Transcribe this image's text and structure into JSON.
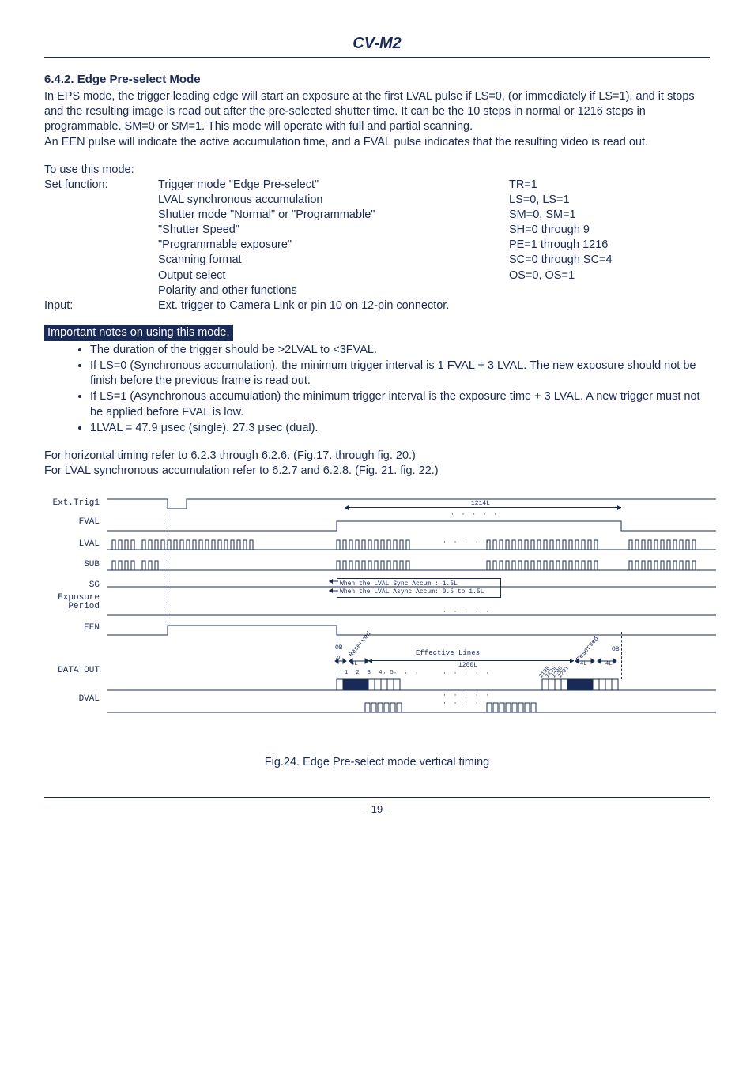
{
  "header": {
    "title": "CV-M2"
  },
  "section": {
    "number_title": "6.4.2. Edge Pre-select Mode",
    "para1": "In EPS mode, the trigger leading edge will start an exposure at the first LVAL pulse if LS=0, (or immediately if LS=1), and it stops and the resulting image is read out after the pre-selected shutter time. It can be the 10 steps in normal or 1216 steps in programmable. SM=0 or SM=1. This mode will operate with full and partial scanning.",
    "para2": "An EEN pulse will indicate the active accumulation time, and a FVAL pulse indicates that the resulting video is read out."
  },
  "settings": {
    "intro": "To use this mode:",
    "label1": "Set function:",
    "label2": "Input:",
    "rows": [
      {
        "name": "Trigger mode \"Edge Pre-select\"",
        "val": "TR=1"
      },
      {
        "name": "LVAL synchronous accumulation",
        "val": "LS=0, LS=1"
      },
      {
        "name": "Shutter mode \"Normal\" or \"Programmable\"",
        "val": "SM=0, SM=1"
      },
      {
        "name": "\"Shutter Speed\"",
        "val": "SH=0 through 9"
      },
      {
        "name": "\"Programmable exposure\"",
        "val": "PE=1 through 1216"
      },
      {
        "name": "Scanning format",
        "val": "SC=0 through SC=4"
      },
      {
        "name": "Output select",
        "val": "OS=0, OS=1"
      },
      {
        "name": "Polarity and other functions",
        "val": ""
      }
    ],
    "input_line": "Ext. trigger to Camera Link or pin 10 on 12-pin connector."
  },
  "notes": {
    "heading": "Important notes on using this mode.",
    "items": [
      "The duration of the trigger should be >2LVAL to <3FVAL.",
      "If LS=0 (Synchronous accumulation), the minimum trigger interval is 1 FVAL + 3 LVAL. The new exposure should not be finish before the previous frame is read out.",
      "If LS=1 (Asynchronous accumulation) the minimum trigger interval is the exposure time + 3 LVAL. A new trigger must not be applied before FVAL is low.",
      "1LVAL = 47.9 μsec (single). 27.3 μsec (dual)."
    ]
  },
  "refs": {
    "line1": "For horizontal timing refer to 6.2.3 through 6.2.6. (Fig.17. through fig. 20.)",
    "line2": "For LVAL synchronous accumulation refer to 6.2.7 and 6.2.8. (Fig. 21. fig. 22.)"
  },
  "diagram": {
    "signals": [
      "Ext.Trig1",
      "FVAL",
      "LVAL",
      "SUB",
      "SG",
      "Exposure Period",
      "EEN",
      "DATA OUT",
      "DVAL"
    ],
    "span_1214L": "1214L",
    "note_sync": "When the LVAL Sync Accum : 1.5L",
    "note_async": "When the LVAL Async Accum: 0.5 to 1.5L",
    "OB": "OB",
    "reserved": "Reserved",
    "twoL": "2L",
    "fourL": "4L",
    "effective_lines": "Effective Lines",
    "span_1200L": "1200L",
    "data_count": "1 2 3 4 5",
    "tick1": "1198",
    "tick2": "1199",
    "tick3": "1200",
    "tick4": "1201"
  },
  "figure_caption": "Fig.24. Edge Pre-select mode vertical timing",
  "page_number": "- 19 -"
}
